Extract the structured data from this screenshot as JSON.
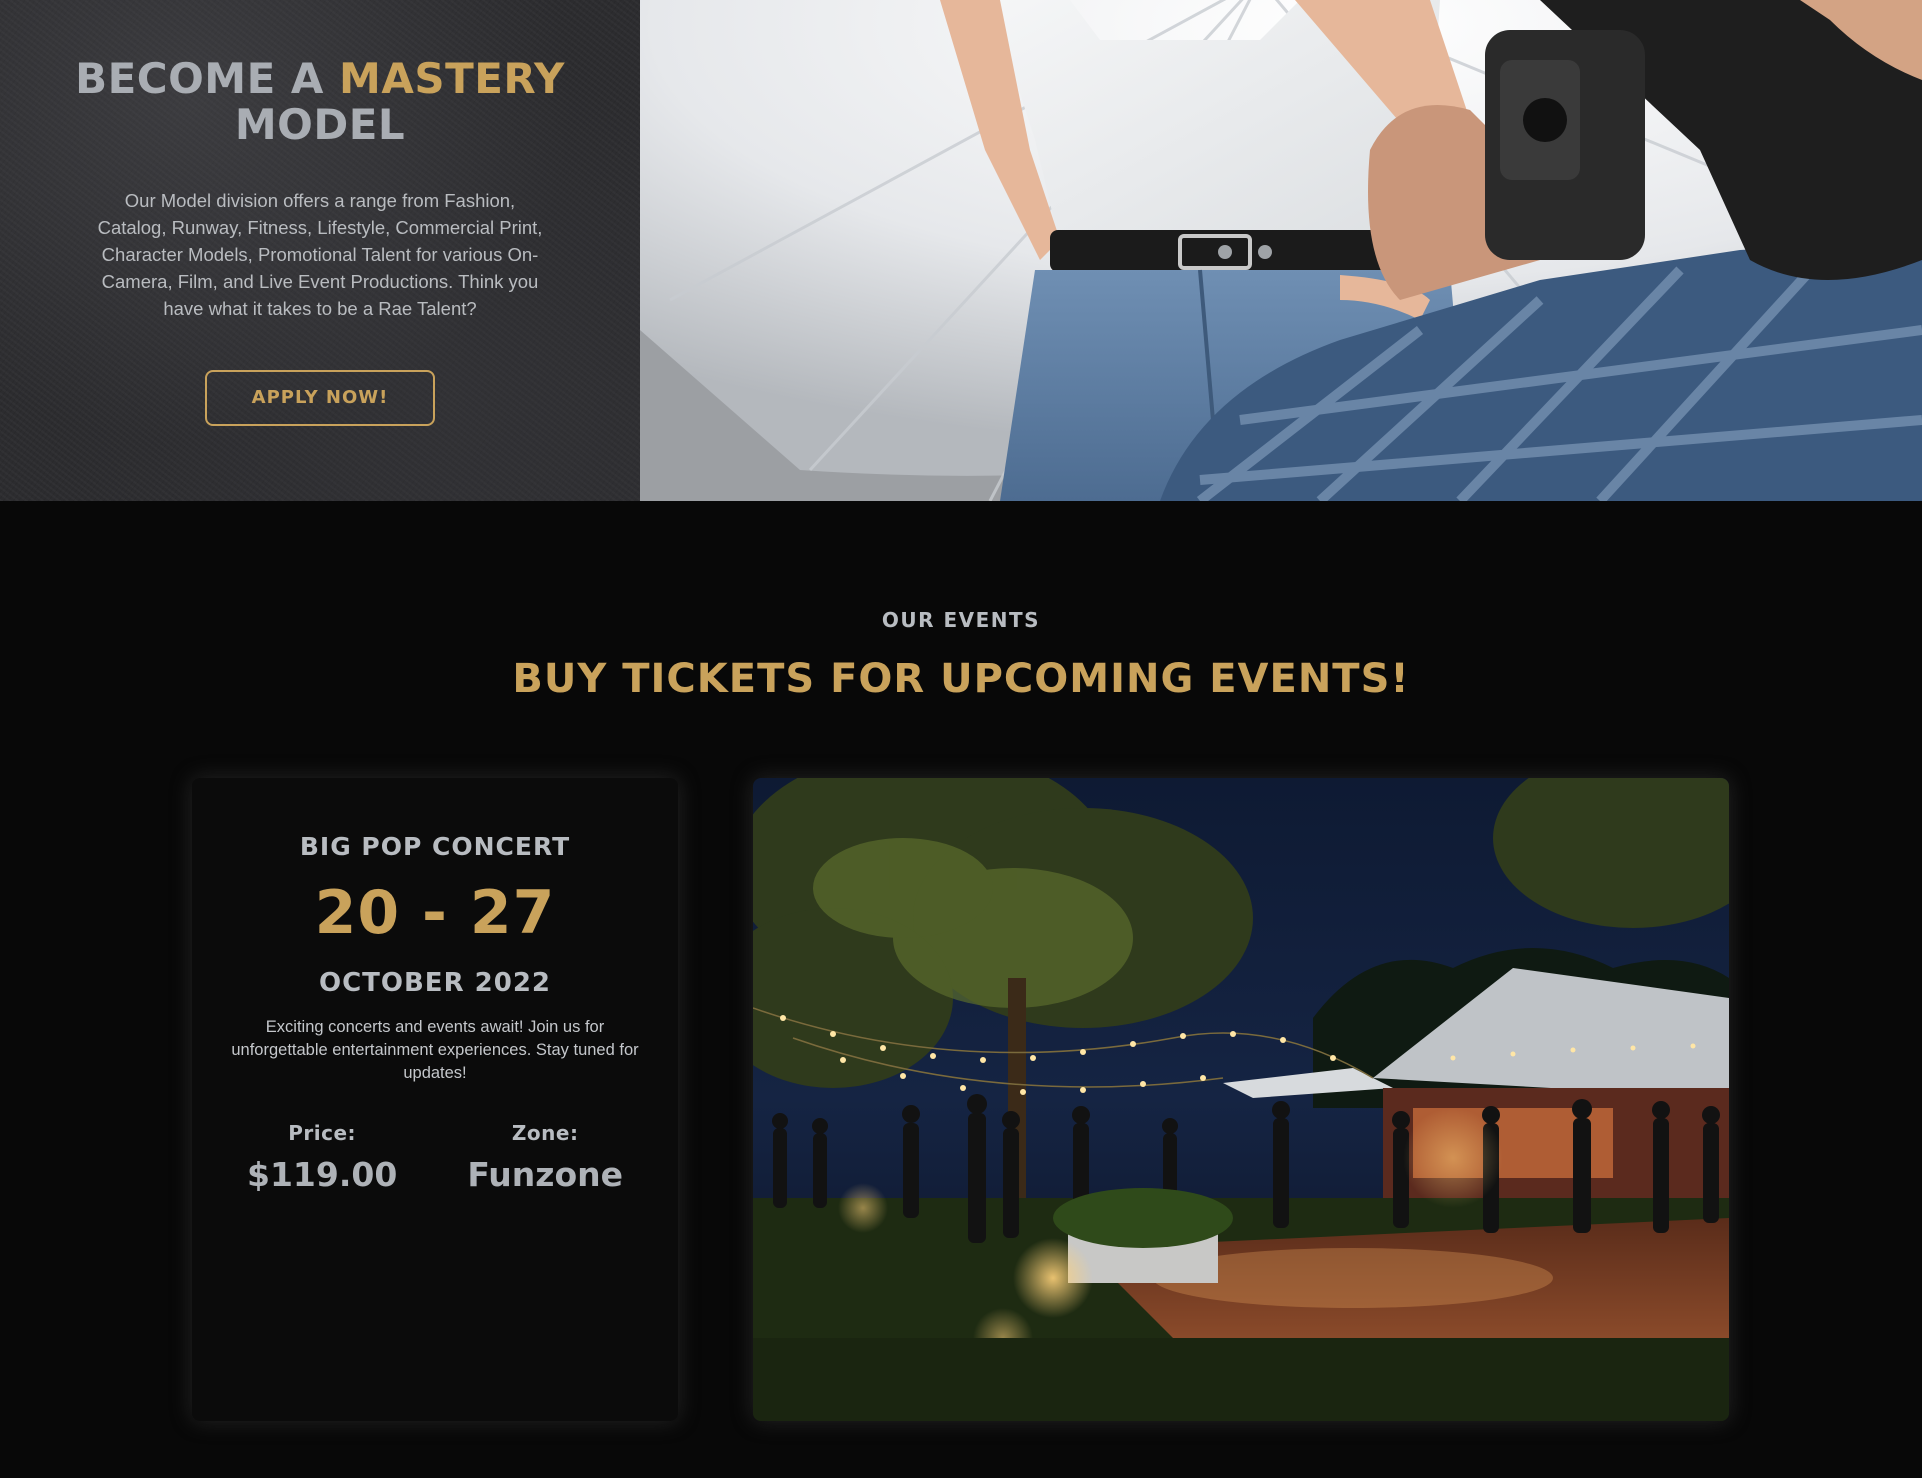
{
  "hero": {
    "title_part1": "BECOME A ",
    "title_accent": "MASTERY",
    "title_part2": "MODEL",
    "description": "Our Model division offers a range from Fashion, Catalog, Runway, Fitness, Lifestyle, Commercial Print, Character Models, Promotional Talent for various On-Camera, Film, and Live Event Productions. Think you have what it takes to be a Rae Talent?",
    "apply_label": "APPLY NOW!",
    "photo_icon": "model-photoshoot-image"
  },
  "events": {
    "eyebrow": "OUR EVENTS",
    "heading": "BUY TICKETS FOR UPCOMING EVENTS!",
    "event": {
      "name": "BIG POP CONCERT",
      "dates": "20 - 27",
      "month": "OCTOBER 2022",
      "description": "Exciting concerts and events await! Join us for unforgettable entertainment experiences. Stay tuned for updates!",
      "price_label": "Price:",
      "price_value": "$119.00",
      "zone_label": "Zone:",
      "zone_value": "Funzone",
      "photo_icon": "outdoor-night-party-image"
    }
  },
  "colors": {
    "accent_gold": "#c9a25b",
    "text_grey": "#b8bcc1",
    "page_bg": "#080808"
  }
}
